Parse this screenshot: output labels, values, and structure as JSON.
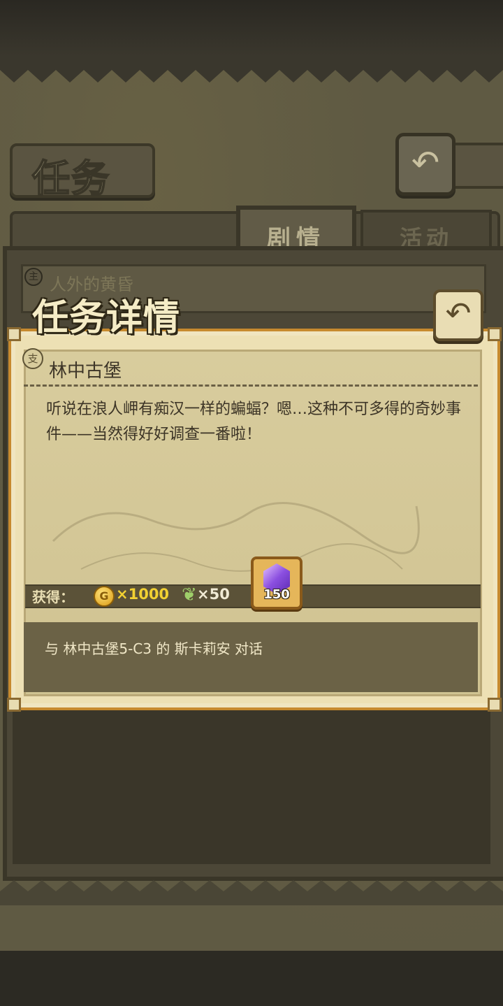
{
  "header": {
    "title": "任务",
    "back_icon": "↶"
  },
  "tabs": [
    {
      "label": "剧情",
      "active": true
    },
    {
      "label": "活动",
      "active": false
    }
  ],
  "quest_list": {
    "items": [
      {
        "badge": "主",
        "name": "人外的黄昏"
      }
    ]
  },
  "detail": {
    "title": "任务详情",
    "back_icon": "↶",
    "quest_badge": "支",
    "quest_name": "林中古堡",
    "description": "听说在浪人岬有痴汉一样的蝙蝠？嗯…这种不可多得的奇妙事件——当然得好好调查一番啦！",
    "rewards": {
      "label": "获得：",
      "gold_icon_letter": "G",
      "gold": "×1000",
      "feather": "×50",
      "crystal_count": "150"
    },
    "objective": "与 林中古堡5-C3 的 斯卡莉安 对话"
  },
  "colors": {
    "dialog_border": "#c78a2e",
    "gold_text": "#f2d132",
    "crystal": "#8b4fe0"
  }
}
